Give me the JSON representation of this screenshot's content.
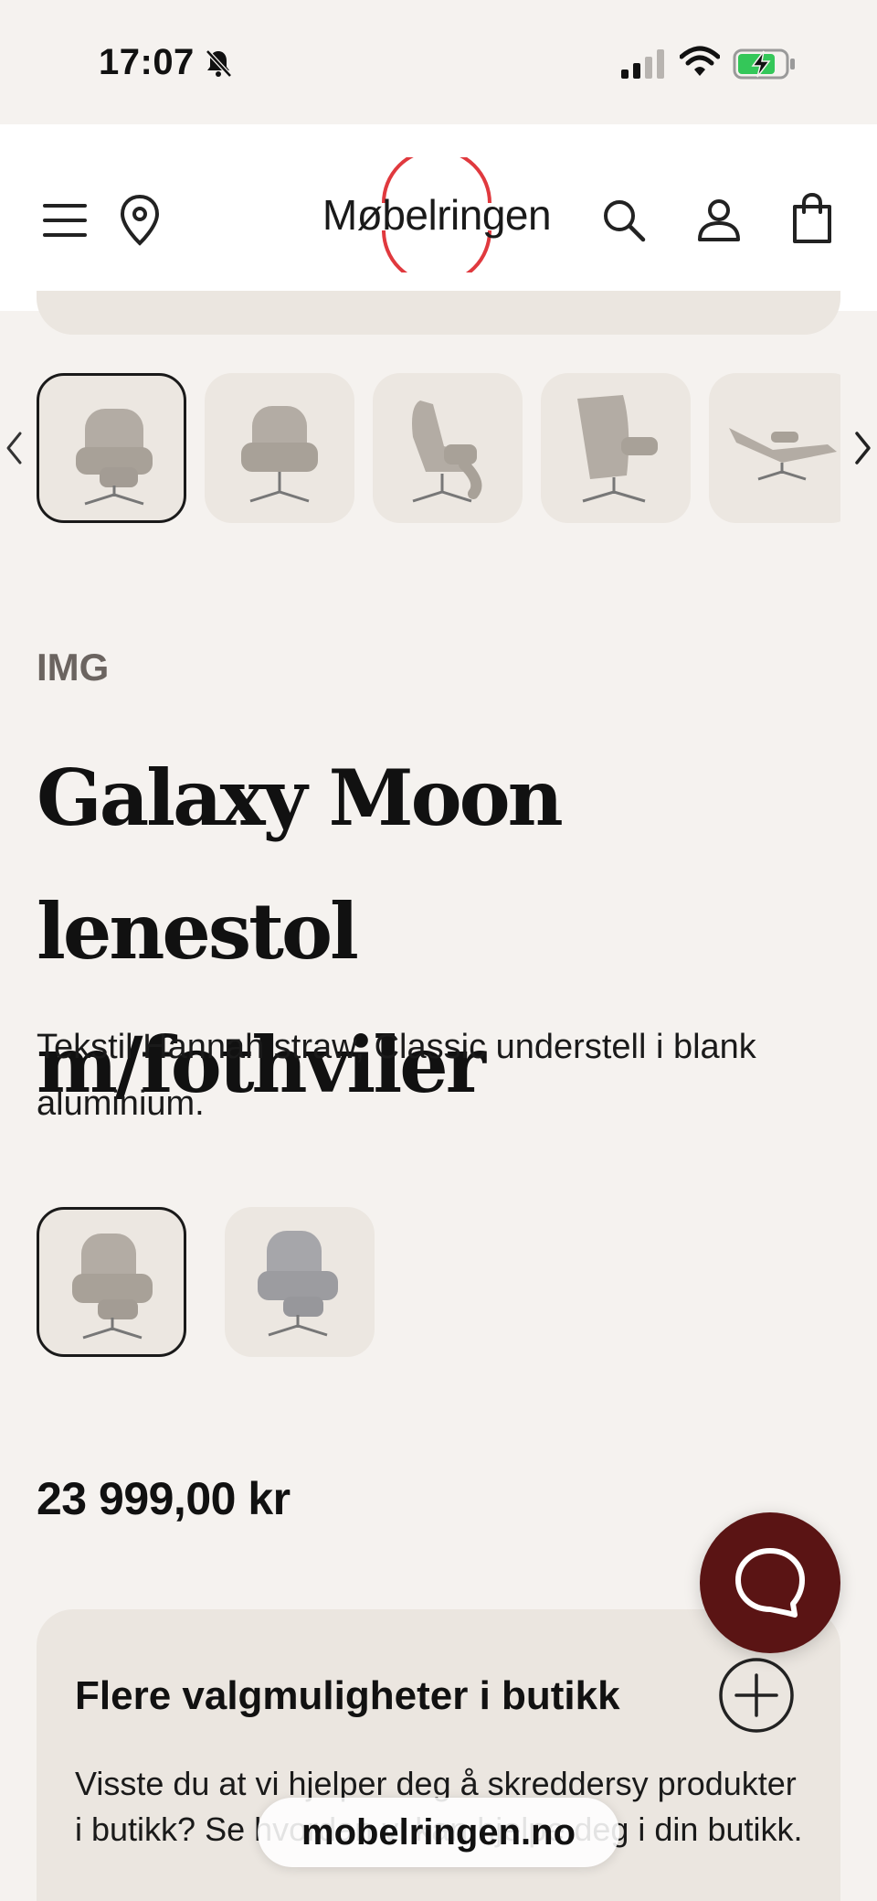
{
  "status_bar": {
    "time": "17:07"
  },
  "header": {
    "logo_text": "Møbelringen",
    "logo_color": "#e0393e"
  },
  "gallery": {
    "icons": [
      "chevron-left-icon",
      "chevron-right-icon"
    ],
    "thumbnails": [
      "front view",
      "front view",
      "side view",
      "back view",
      "reclined view"
    ],
    "selected_index": 0
  },
  "product": {
    "brand": "IMG",
    "title_line1": "Galaxy Moon lenestol",
    "title_line2": "m/fothviler",
    "description": "Tekstil Hannah straw, Classic understell i blank aluminium.",
    "variants": [
      "straw",
      "grey"
    ],
    "selected_variant": 0,
    "price": "23 999,00 kr"
  },
  "chat": {
    "color": "#5a1414"
  },
  "store_panel": {
    "title": "Flere valgmuligheter i butikk",
    "text": "Visste du at vi hjelper deg å skreddersy produkter i butikk? Se hvordan vi kan hjelpe deg i din butikk."
  },
  "browser": {
    "url": "mobelringen.no"
  }
}
